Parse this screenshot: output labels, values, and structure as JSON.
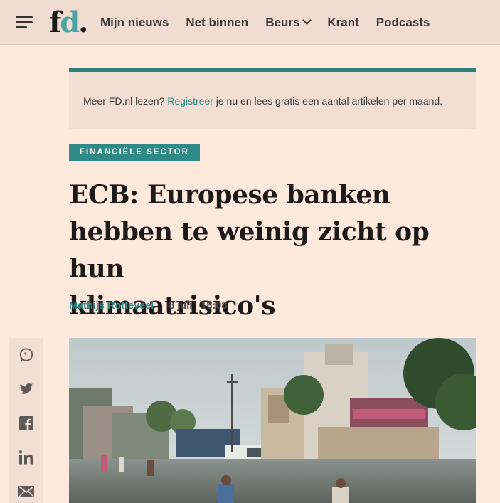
{
  "header": {
    "logo_f": "f",
    "logo_d": "d",
    "logo_dot": ".",
    "nav": [
      "Mijn nieuws",
      "Net binnen",
      "Beurs",
      "Krant",
      "Podcasts"
    ]
  },
  "banner": {
    "text_before": "Meer FD.nl lezen? ",
    "link": "Registreer",
    "text_after": " je nu en lees gratis een aantal artikelen per maand."
  },
  "article": {
    "tag": "FINANCIËLE SECTOR",
    "headline_lines": [
      "ECB: Europese banken",
      "hebben te weinig zicht op hun",
      "klimaatrisico's"
    ],
    "author": "Mathijs Rotteveel",
    "date": "8 juli",
    "time": "18:08"
  },
  "share": [
    "whatsapp-icon",
    "twitter-icon",
    "facebook-icon",
    "linkedin-icon",
    "email-icon"
  ],
  "colors": {
    "accent": "#2f8a87",
    "background": "#ffe9dc",
    "header": "#f0dcd0"
  }
}
